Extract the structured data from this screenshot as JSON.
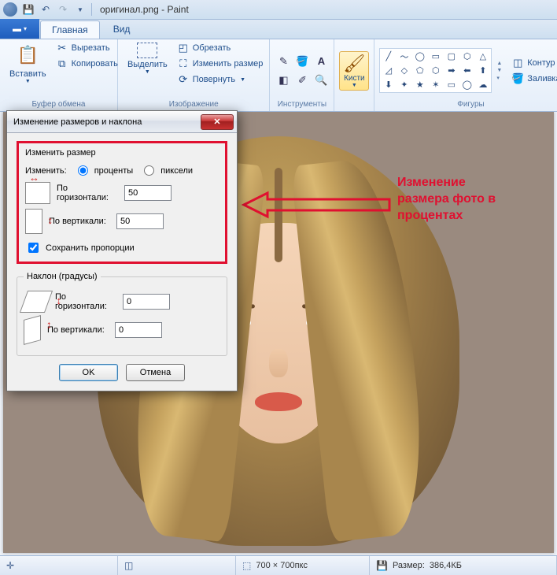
{
  "title": "оригинал.png - Paint",
  "tabs": {
    "file_arrow": "▾",
    "main": "Главная",
    "view": "Вид"
  },
  "ribbon": {
    "clipboard": {
      "label": "Буфер обмена",
      "paste": "Вставить",
      "cut": "Вырезать",
      "copy": "Копировать"
    },
    "image": {
      "label": "Изображение",
      "select": "Выделить",
      "crop": "Обрезать",
      "resize": "Изменить размер",
      "rotate": "Повернуть"
    },
    "tools": {
      "label": "Инструменты"
    },
    "brushes": {
      "label": "Кисти"
    },
    "shapes": {
      "label": "Фигуры",
      "outline": "Контур",
      "fill": "Заливка"
    }
  },
  "dialog": {
    "title": "Изменение размеров и наклона",
    "resize_legend": "Изменить размер",
    "change_label": "Изменить:",
    "percent": "проценты",
    "pixels": "пиксели",
    "horizontal": "По горизонтали:",
    "vertical": "По вертикали:",
    "h_value": "50",
    "v_value": "50",
    "keep_aspect": "Сохранить пропорции",
    "skew_legend": "Наклон (градусы)",
    "skew_h_value": "0",
    "skew_v_value": "0",
    "ok": "OK",
    "cancel": "Отмена"
  },
  "annotation": {
    "l1": "Изменение",
    "l2": "размера фото в",
    "l3": "процентах"
  },
  "status": {
    "dims": "700 × 700пкс",
    "size_label": "Размер:",
    "size_value": "386,4КБ"
  }
}
